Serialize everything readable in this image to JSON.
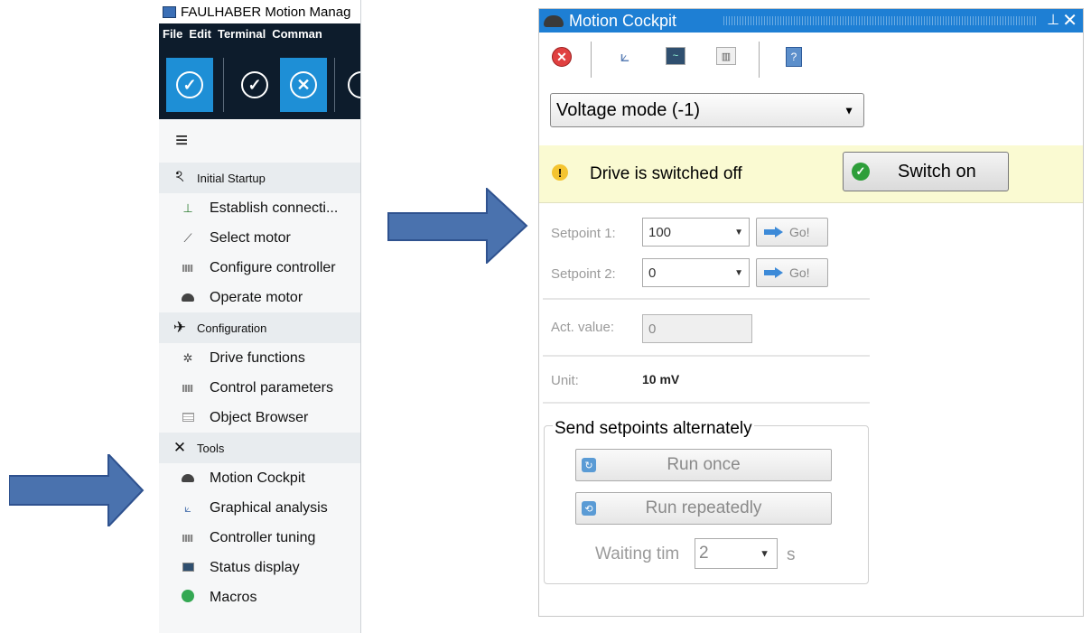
{
  "nav": {
    "app_title": "FAULHABER Motion Manag",
    "menu": [
      "File",
      "Edit",
      "Terminal",
      "Comman"
    ],
    "sections": [
      {
        "title": "Initial Startup",
        "items": [
          "Establish connecti...",
          "Select motor",
          "Configure controller",
          "Operate motor"
        ]
      },
      {
        "title": "Configuration",
        "items": [
          "Drive functions",
          "Control parameters",
          "Object Browser"
        ]
      },
      {
        "title": "Tools",
        "items": [
          "Motion Cockpit",
          "Graphical analysis",
          "Controller tuning",
          "Status display",
          "Macros"
        ]
      }
    ]
  },
  "cockpit": {
    "title": "Motion Cockpit",
    "mode": "Voltage mode (-1)",
    "status_text": "Drive is switched off",
    "switch_label": "Switch on",
    "setpoint1_label": "Setpoint 1:",
    "setpoint1_value": "100",
    "setpoint2_label": "Setpoint 2:",
    "setpoint2_value": "0",
    "go_label": "Go!",
    "act_label": "Act. value:",
    "act_value": "0",
    "unit_label": "Unit:",
    "unit_value": "10 mV",
    "group_title": "Send setpoints alternately",
    "run_once": "Run once",
    "run_repeatedly": "Run repeatedly",
    "waiting_label": "Waiting tim",
    "waiting_value": "2",
    "waiting_unit": "s"
  },
  "colors": {
    "nav_dark": "#0d1c2c",
    "toolbar_active": "#1e8fd6",
    "cockpit_title": "#1e7fd4",
    "status_bg": "#fafad2",
    "arrow_fill": "#4a72ae"
  }
}
